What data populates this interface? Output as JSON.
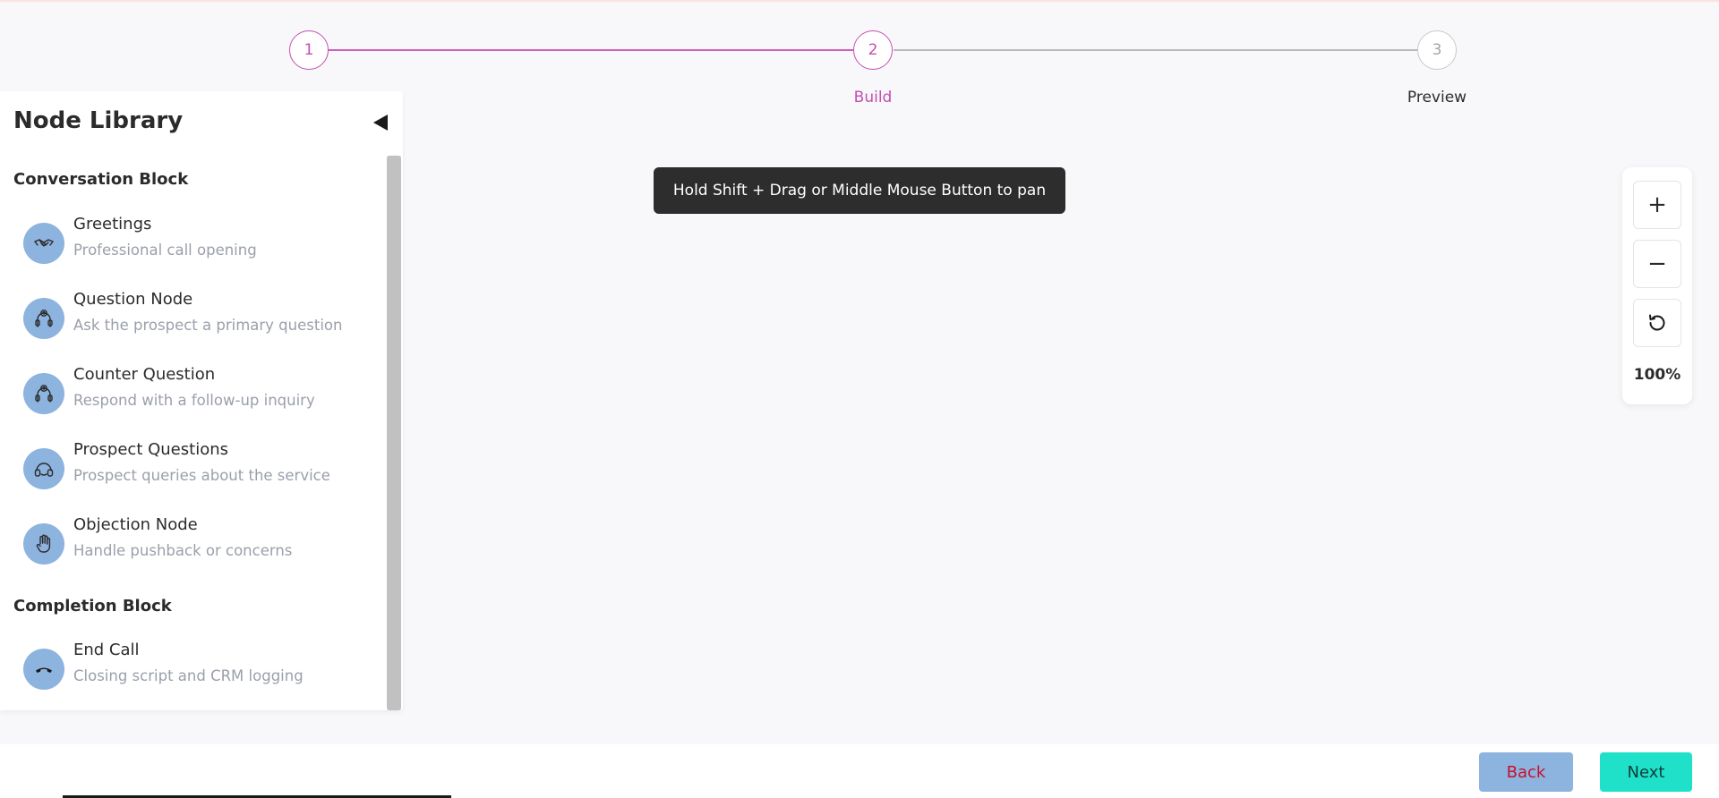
{
  "stepper": {
    "steps": [
      {
        "number": "1",
        "label": ""
      },
      {
        "number": "2",
        "label": "Build"
      },
      {
        "number": "3",
        "label": "Preview"
      }
    ],
    "current_step": 2,
    "colors": {
      "active": "#c44fb1",
      "inactive": "#c8c8c8"
    }
  },
  "sidebar": {
    "title": "Node Library",
    "collapse_icon": "triangle-left-icon",
    "blocks": [
      {
        "heading": "Conversation Block",
        "items": [
          {
            "title": "Greetings",
            "description": "Professional call opening",
            "icon": "handshake-icon"
          },
          {
            "title": "Question Node",
            "description": "Ask the prospect a primary question",
            "icon": "question-head-icon"
          },
          {
            "title": "Counter Question",
            "description": "Respond with a follow-up inquiry",
            "icon": "question-head-icon"
          },
          {
            "title": "Prospect Questions",
            "description": "Prospect queries about the service",
            "icon": "headset-icon"
          },
          {
            "title": "Objection Node",
            "description": "Handle pushback or concerns",
            "icon": "hand-stop-icon"
          }
        ]
      },
      {
        "heading": "Completion Block",
        "items": [
          {
            "title": "End Call",
            "description": "Closing script and CRM logging",
            "icon": "phone-hangup-icon"
          }
        ]
      }
    ]
  },
  "canvas": {
    "tooltip": "Hold Shift + Drag or Middle Mouse Button to pan"
  },
  "zoom": {
    "zoom_in_label": "+",
    "zoom_out_label": "−",
    "reset_icon": "reset-icon",
    "level": "100%"
  },
  "footer": {
    "back_label": "Back",
    "next_label": "Next",
    "colors": {
      "back_bg": "#8db3df",
      "back_text": "#c8102e",
      "next_bg": "#1fe0c9"
    }
  }
}
